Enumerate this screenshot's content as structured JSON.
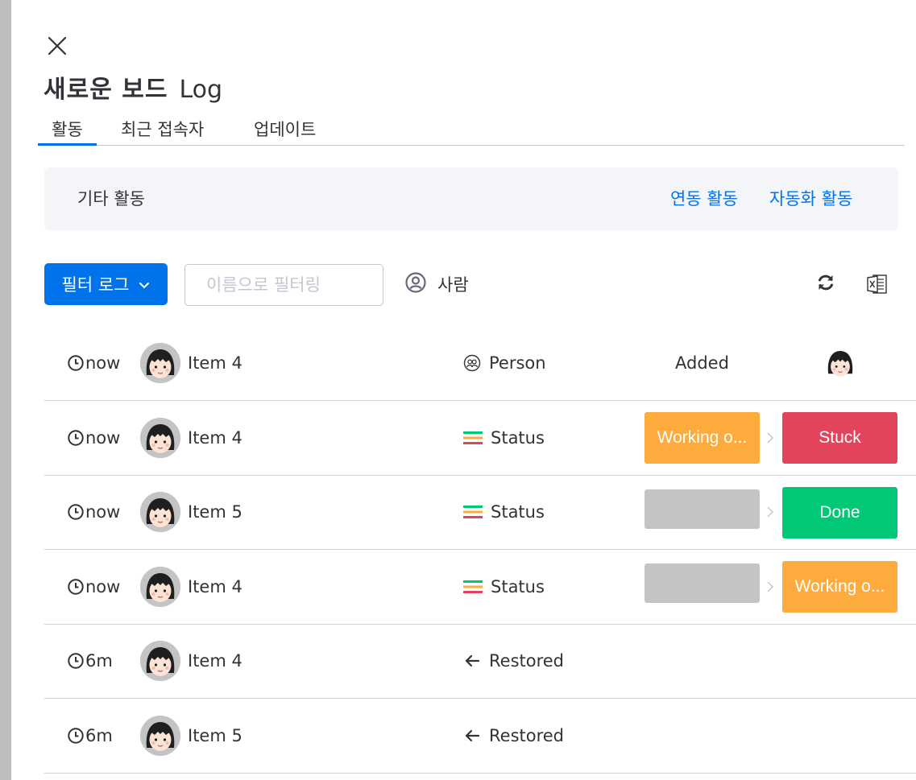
{
  "header": {
    "board_name": "새로운 보드",
    "log_label": "Log"
  },
  "tabs": [
    {
      "label": "활동",
      "active": true
    },
    {
      "label": "최근 접속자",
      "active": false
    },
    {
      "label": "업데이트",
      "active": false
    }
  ],
  "activity_bar": {
    "other_label": "기타 활동",
    "integration_link": "연동 활동",
    "automation_link": "자동화 활동"
  },
  "toolbar": {
    "filter_button": "필터 로그",
    "name_filter_placeholder": "이름으로 필터링",
    "person_filter": "사람"
  },
  "colors": {
    "accent": "#0073ea",
    "stuck": "#e2445c",
    "done": "#00c875",
    "working": "#fdab3d",
    "empty": "#c4c4c4"
  },
  "rows": [
    {
      "time": "now",
      "item": "Item 4",
      "column_icon": "person-column-icon",
      "column": "Person",
      "action": "Added"
    },
    {
      "time": "now",
      "item": "Item 4",
      "column_icon": "status-column-icon",
      "column": "Status",
      "old_value": "Working o...",
      "new_value": "Stuck"
    },
    {
      "time": "now",
      "item": "Item 5",
      "column_icon": "status-column-icon",
      "column": "Status",
      "old_value": "",
      "new_value": "Done"
    },
    {
      "time": "now",
      "item": "Item 4",
      "column_icon": "status-column-icon",
      "column": "Status",
      "old_value": "",
      "new_value": "Working o..."
    },
    {
      "time": "6m",
      "item": "Item 4",
      "column_icon": "arrow-left-icon",
      "column": "Restored"
    },
    {
      "time": "6m",
      "item": "Item 5",
      "column_icon": "arrow-left-icon",
      "column": "Restored"
    }
  ]
}
